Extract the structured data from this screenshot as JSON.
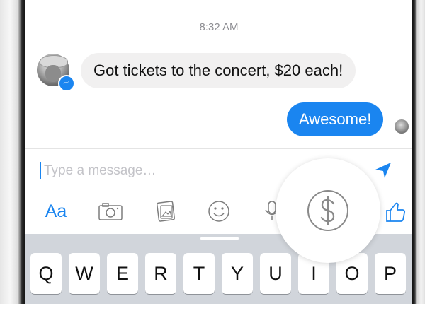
{
  "chat": {
    "timestamp": "8:32 AM",
    "incoming_message": "Got tickets to the concert, $20 each!",
    "outgoing_message": "Awesome!"
  },
  "composer": {
    "placeholder": "Type a message…"
  },
  "toolbar": {
    "text_label": "Aa"
  },
  "keyboard": {
    "keys": [
      "Q",
      "W",
      "E",
      "R",
      "T",
      "Y",
      "U",
      "I",
      "O",
      "P"
    ]
  },
  "colors": {
    "messenger_blue": "#1a85f0",
    "incoming_bubble": "#f1f0f0",
    "keyboard_bg": "#d1d5db"
  },
  "icons": {
    "send": "send-arrow-icon",
    "camera": "camera-icon",
    "gallery": "photo-gallery-icon",
    "emoji": "smiley-icon",
    "microphone": "microphone-icon",
    "payment": "dollar-sign-icon",
    "like": "thumbs-up-icon"
  }
}
